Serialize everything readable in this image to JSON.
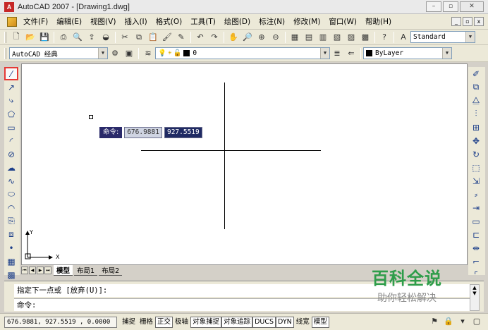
{
  "window": {
    "title": "AutoCAD 2007 - [Drawing1.dwg]",
    "icon_label": "A",
    "controls": [
      "minimize-icon",
      "maximize-icon",
      "close-icon"
    ]
  },
  "menubar": {
    "items": [
      "文件(F)",
      "编辑(E)",
      "视图(V)",
      "插入(I)",
      "格式(O)",
      "工具(T)",
      "绘图(D)",
      "标注(N)",
      "修改(M)",
      "窗口(W)",
      "帮助(H)"
    ],
    "mdi_controls": [
      "_",
      "▫",
      "x"
    ]
  },
  "toolbar1": {
    "text_style": "Standard"
  },
  "toolbar2": {
    "workspace": "AutoCAD 经典",
    "layer": "0",
    "color": "ByLayer"
  },
  "canvas": {
    "background": "#ffffff",
    "dyn_prompt_label": "命令:",
    "dyn_x": "676.9881",
    "dyn_y": "927.5519",
    "ucs_y_label": "Y",
    "ucs_x_label": "X"
  },
  "tabs": {
    "items": [
      "模型",
      "布局1",
      "布局2"
    ],
    "active": "模型"
  },
  "command": {
    "line1": "指定下一点或 [放弃(U)]:",
    "line2": "命令:"
  },
  "watermark": {
    "main": "百科全说",
    "sub": "助你轻松解决"
  },
  "statusbar": {
    "coords": "676.9881, 927.5519 , 0.0000",
    "buttons": [
      "捕捉",
      "栅格",
      "正交",
      "极轴",
      "对象捕捉",
      "对象追踪",
      "DUCS",
      "DYN",
      "线宽",
      "模型"
    ],
    "on_buttons": [
      "正交",
      "对象捕捉",
      "对象追踪",
      "DUCS",
      "DYN",
      "模型"
    ]
  },
  "colors": {
    "accent": "#e53935",
    "icon_blue": "#1d3f8a",
    "dyn_bg": "#1f2a63",
    "watermark_green": "#2e9d4a"
  }
}
